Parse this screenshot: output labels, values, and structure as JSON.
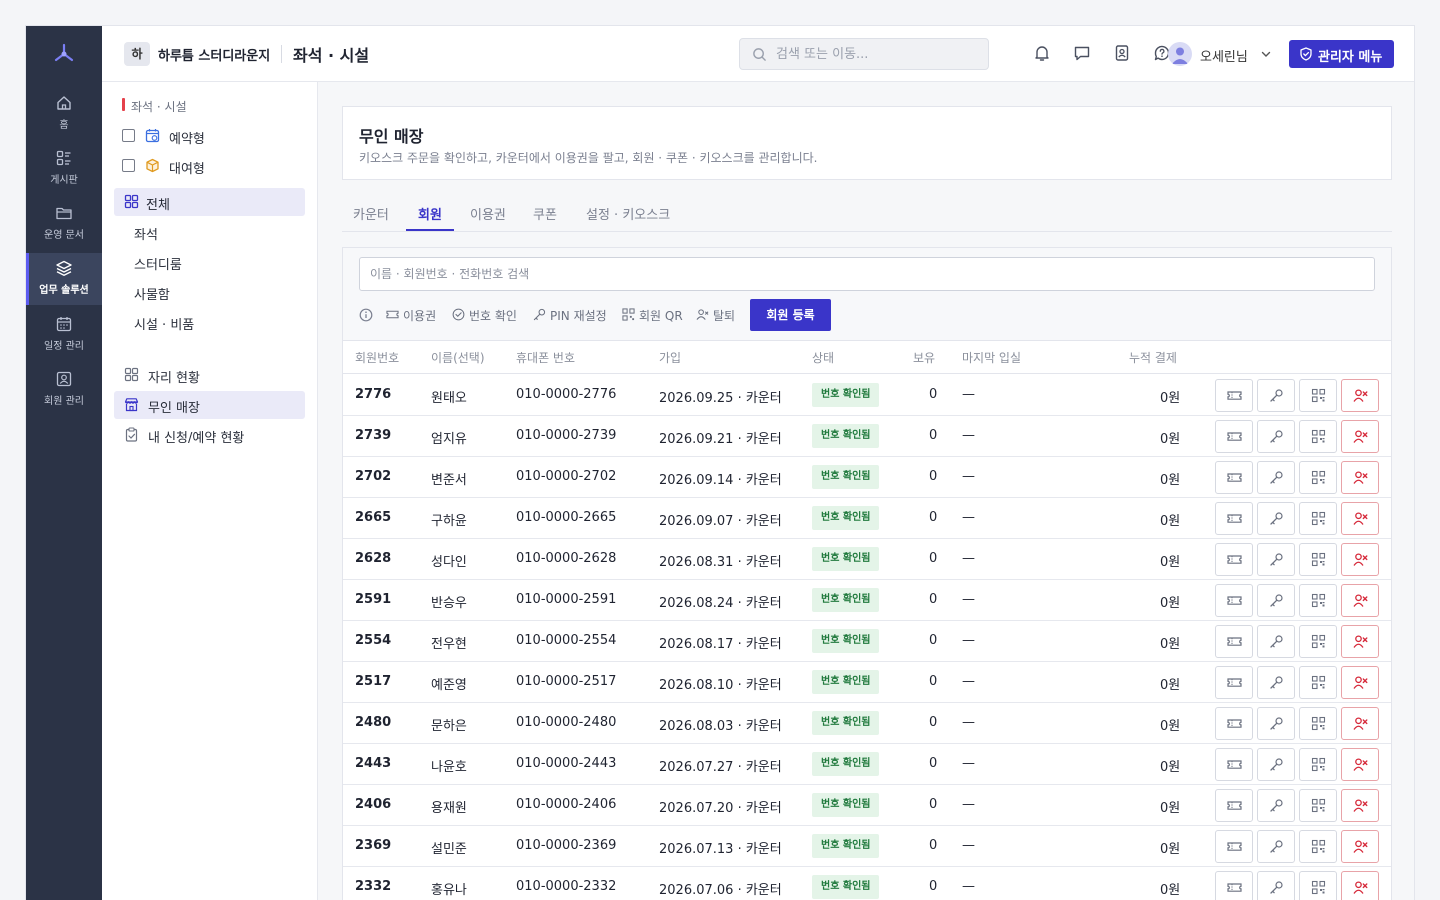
{
  "rail": {
    "items": [
      {
        "label": "홈",
        "icon": "home-icon"
      },
      {
        "label": "게시판",
        "icon": "board-icon"
      },
      {
        "label": "운영 문서",
        "icon": "folder-icon"
      },
      {
        "label": "업무 솔루션",
        "icon": "layers-icon"
      },
      {
        "label": "일정 관리",
        "icon": "calendar-icon"
      },
      {
        "label": "회원 관리",
        "icon": "member-icon"
      }
    ],
    "active": "업무 솔루션"
  },
  "header": {
    "brand_badge": "하",
    "brand_name": "하루틈 스터디라운지",
    "page_title": "좌석 · 시설",
    "search_placeholder": "검색 또는 이동...",
    "user_name": "오세린님",
    "admin_button": "관리자 메뉴"
  },
  "sidebar": {
    "group_title": "좌석 · 시설",
    "filters": [
      {
        "label": "예약형",
        "icon": "calendar-clock-icon"
      },
      {
        "label": "대여형",
        "icon": "box-icon"
      }
    ],
    "all_label": "전체",
    "subitems": [
      "좌석",
      "스터디룸",
      "사물함",
      "시설 · 비품"
    ],
    "links": [
      {
        "label": "자리 현황",
        "icon": "grid-icon"
      },
      {
        "label": "무인 매장",
        "icon": "store-icon"
      },
      {
        "label": "내 신청/예약 현황",
        "icon": "clipboard-icon"
      }
    ]
  },
  "page": {
    "title": "무인 매장",
    "description": "키오스크 주문을 확인하고, 카운터에서 이용권을 팔고, 회원 · 쿠폰 · 키오스크를 관리합니다."
  },
  "tabs": [
    "카운터",
    "회원",
    "이용권",
    "쿠폰",
    "설정 · 키오스크"
  ],
  "active_tab": "회원",
  "members": {
    "search_placeholder": "이름 · 회원번호 · 전화번호 검색",
    "tools": [
      "이용권",
      "번호 확인",
      "PIN 재설정",
      "회원 QR",
      "탈퇴"
    ],
    "register_button": "회원 등록",
    "columns": [
      "회원번호",
      "이름(선택)",
      "휴대폰 번호",
      "가입",
      "상태",
      "보유",
      "마지막 입실",
      "누적 결제"
    ],
    "rows": [
      {
        "id": "2776",
        "name": "원태오",
        "phone": "010-0000-2776",
        "joined": "2026.09.25 · 카운터",
        "status": "번호 확인됨",
        "held": "0",
        "last": "—",
        "total": "0원"
      },
      {
        "id": "2739",
        "name": "엄지유",
        "phone": "010-0000-2739",
        "joined": "2026.09.21 · 카운터",
        "status": "번호 확인됨",
        "held": "0",
        "last": "—",
        "total": "0원"
      },
      {
        "id": "2702",
        "name": "변준서",
        "phone": "010-0000-2702",
        "joined": "2026.09.14 · 카운터",
        "status": "번호 확인됨",
        "held": "0",
        "last": "—",
        "total": "0원"
      },
      {
        "id": "2665",
        "name": "구하윤",
        "phone": "010-0000-2665",
        "joined": "2026.09.07 · 카운터",
        "status": "번호 확인됨",
        "held": "0",
        "last": "—",
        "total": "0원"
      },
      {
        "id": "2628",
        "name": "성다인",
        "phone": "010-0000-2628",
        "joined": "2026.08.31 · 카운터",
        "status": "번호 확인됨",
        "held": "0",
        "last": "—",
        "total": "0원"
      },
      {
        "id": "2591",
        "name": "반승우",
        "phone": "010-0000-2591",
        "joined": "2026.08.24 · 카운터",
        "status": "번호 확인됨",
        "held": "0",
        "last": "—",
        "total": "0원"
      },
      {
        "id": "2554",
        "name": "전우현",
        "phone": "010-0000-2554",
        "joined": "2026.08.17 · 카운터",
        "status": "번호 확인됨",
        "held": "0",
        "last": "—",
        "total": "0원"
      },
      {
        "id": "2517",
        "name": "예준영",
        "phone": "010-0000-2517",
        "joined": "2026.08.10 · 카운터",
        "status": "번호 확인됨",
        "held": "0",
        "last": "—",
        "total": "0원"
      },
      {
        "id": "2480",
        "name": "문하은",
        "phone": "010-0000-2480",
        "joined": "2026.08.03 · 카운터",
        "status": "번호 확인됨",
        "held": "0",
        "last": "—",
        "total": "0원"
      },
      {
        "id": "2443",
        "name": "나윤호",
        "phone": "010-0000-2443",
        "joined": "2026.07.27 · 카운터",
        "status": "번호 확인됨",
        "held": "0",
        "last": "—",
        "total": "0원"
      },
      {
        "id": "2406",
        "name": "용재원",
        "phone": "010-0000-2406",
        "joined": "2026.07.20 · 카운터",
        "status": "번호 확인됨",
        "held": "0",
        "last": "—",
        "total": "0원"
      },
      {
        "id": "2369",
        "name": "설민준",
        "phone": "010-0000-2369",
        "joined": "2026.07.13 · 카운터",
        "status": "번호 확인됨",
        "held": "0",
        "last": "—",
        "total": "0원"
      },
      {
        "id": "2332",
        "name": "홍유나",
        "phone": "010-0000-2332",
        "joined": "2026.07.06 · 카운터",
        "status": "번호 확인됨",
        "held": "0",
        "last": "—",
        "total": "0원"
      }
    ],
    "row_actions": [
      "ticket-icon",
      "key-icon",
      "qr-icon",
      "user-remove-icon"
    ]
  },
  "colors": {
    "accent": "#3a35c9",
    "rail_bg": "#2b3346",
    "badge_bg": "#e4f4e8",
    "badge_text": "#207a3d",
    "danger": "#d62839"
  }
}
